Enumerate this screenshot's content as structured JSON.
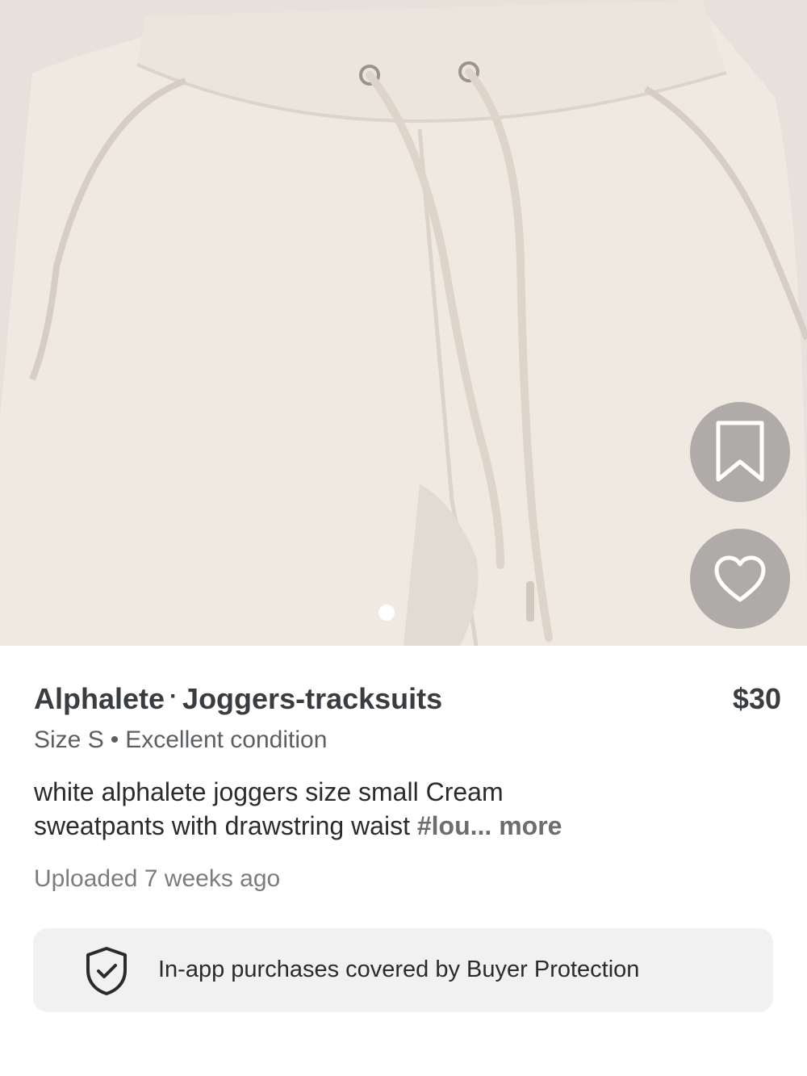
{
  "listing": {
    "brand": "Alphalete",
    "category": "Joggers-tracksuits",
    "price": "$30",
    "size": "Size S",
    "condition": "Excellent condition",
    "description_line1": "white alphalete joggers size small Cream",
    "description_line2": "sweatpants with drawstring waist",
    "hashtag": "#lou...",
    "more_label": "more",
    "uploaded": "Uploaded 7 weeks ago"
  },
  "gallery": {
    "current_index": 1,
    "total": 1
  },
  "actions": {
    "save_icon": "bookmark-icon",
    "like_icon": "heart-icon"
  },
  "buyer_protection": {
    "icon": "shield-check-icon",
    "text": "In-app purchases covered by Buyer Protection"
  },
  "colors": {
    "title_text": "#3a3d40",
    "secondary_text": "#5c5f62",
    "muted_text": "#7a7d80",
    "panel_bg": "#f1f1f1",
    "fab_bg": "#787878"
  }
}
